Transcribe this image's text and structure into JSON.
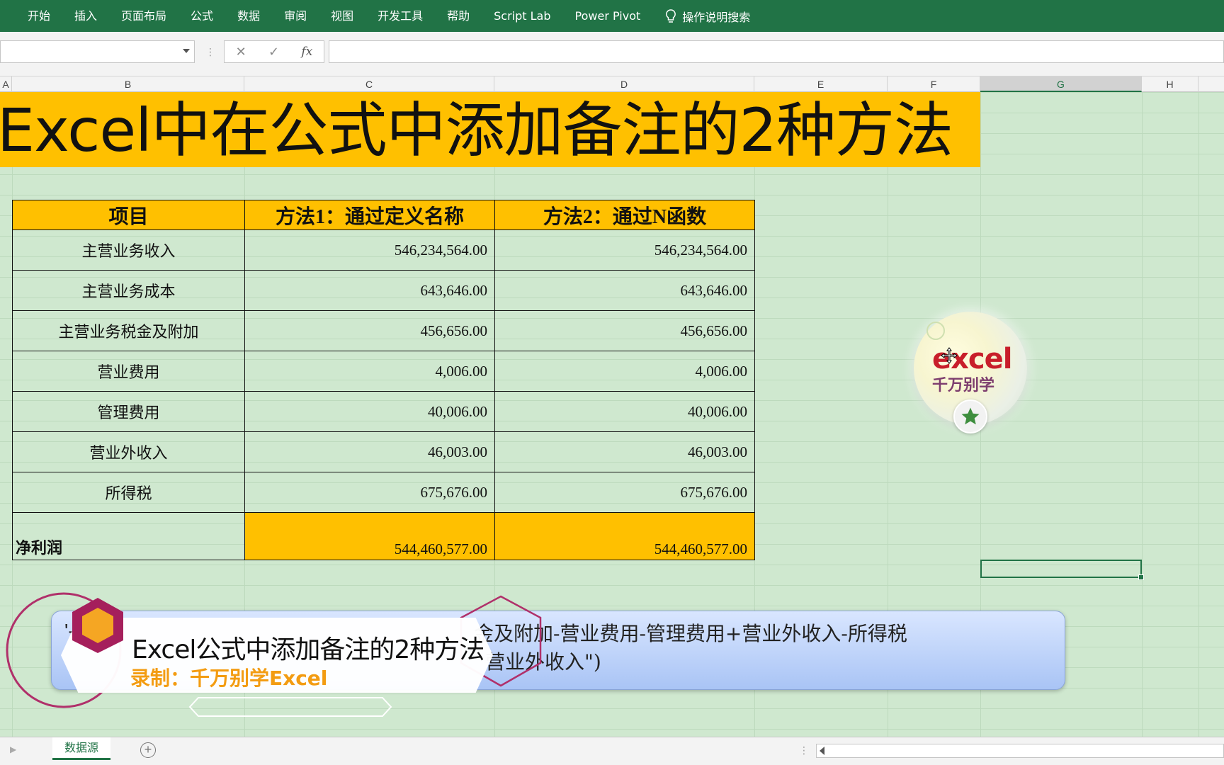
{
  "ribbon": {
    "tabs": [
      "开始",
      "插入",
      "页面布局",
      "公式",
      "数据",
      "审阅",
      "视图",
      "开发工具",
      "帮助",
      "Script Lab",
      "Power Pivot"
    ],
    "search_label": "操作说明搜索"
  },
  "formula_bar": {
    "cancel_symbol": "✕",
    "enter_symbol": "✓",
    "fx_label": "fx",
    "name_box_value": "",
    "formula_value": ""
  },
  "columns": [
    "A",
    "B",
    "C",
    "D",
    "E",
    "F",
    "G",
    "H"
  ],
  "selected_column": "G",
  "title": "Excel中在公式中添加备注的2种方法",
  "table": {
    "headers": [
      "项目",
      "方法1：通过定义名称",
      "方法2：通过N函数"
    ],
    "rows": [
      {
        "item": "主营业务收入",
        "m1": "546,234,564.00",
        "m2": "546,234,564.00"
      },
      {
        "item": "主营业务成本",
        "m1": "643,646.00",
        "m2": "643,646.00"
      },
      {
        "item": "主营业务税金及附加",
        "m1": "456,656.00",
        "m2": "456,656.00"
      },
      {
        "item": "营业费用",
        "m1": "4,006.00",
        "m2": "4,006.00"
      },
      {
        "item": "管理费用",
        "m1": "40,006.00",
        "m2": "40,006.00"
      },
      {
        "item": "营业外收入",
        "m1": "46,003.00",
        "m2": "46,003.00"
      },
      {
        "item": "所得税",
        "m1": "675,676.00",
        "m2": "675,676.00"
      }
    ],
    "total": {
      "item": "净利润",
      "m1": "544,460,577.00",
      "m2": "544,460,577.00"
    }
  },
  "formula_overlay": {
    "prefix": "'-",
    "line1": "金及附加-营业费用-管理费用+营业外收入-所得税",
    "line2": "营业外收入\")"
  },
  "badge": {
    "line1": "excel",
    "line2": "千万别学"
  },
  "caption": {
    "title": "Excel公式中添加备注的2种方法",
    "subtitle": "录制：千万别学Excel"
  },
  "sheets": [
    "数据源"
  ],
  "colors": {
    "excel_green": "#217346",
    "header_yellow": "#ffc000",
    "sheet_bg": "#cfe8cf",
    "caption_orange": "#f39c12"
  }
}
